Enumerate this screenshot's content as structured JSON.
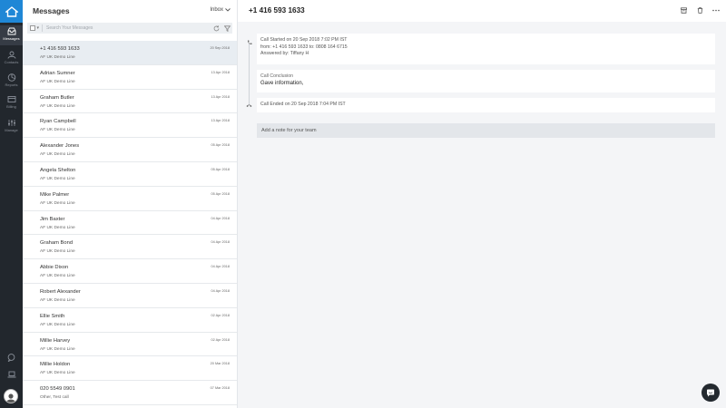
{
  "rail": {
    "items": [
      {
        "label": "Messages",
        "icon": "inbox-icon"
      },
      {
        "label": "Contacts",
        "icon": "contacts-icon"
      },
      {
        "label": "Reports",
        "icon": "reports-icon"
      },
      {
        "label": "Billing",
        "icon": "billing-icon"
      },
      {
        "label": "Manage",
        "icon": "sliders-icon"
      }
    ],
    "accent": "#1f87d6"
  },
  "list": {
    "title": "Messages",
    "filter": "Inbox",
    "search_placeholder": "Search Your Messages",
    "rows": [
      {
        "name": "+1 416 593 1633",
        "sub": "AF UK Demo Line",
        "date": "20 Sep 2018"
      },
      {
        "name": "Adrian Sumner",
        "sub": "AF UK Demo Line",
        "date": "13 Apr 2018"
      },
      {
        "name": "Graham Butler",
        "sub": "AF UK Demo Line",
        "date": "13 Apr 2018"
      },
      {
        "name": "Ryan Campbell",
        "sub": "AF UK Demo Line",
        "date": "13 Apr 2018"
      },
      {
        "name": "Alexander Jones",
        "sub": "AF UK Demo Line",
        "date": "05 Apr 2018"
      },
      {
        "name": "Angela Shelton",
        "sub": "AF UK Demo Line",
        "date": "05 Apr 2018"
      },
      {
        "name": "Mike Palmer",
        "sub": "AF UK Demo Line",
        "date": "05 Apr 2018"
      },
      {
        "name": "Jim Baxter",
        "sub": "AF UK Demo Line",
        "date": "04 Apr 2018"
      },
      {
        "name": "Graham Bond",
        "sub": "AF UK Demo Line",
        "date": "04 Apr 2018"
      },
      {
        "name": "Abbie Dixon",
        "sub": "AF UK Demo Line",
        "date": "04 Apr 2018"
      },
      {
        "name": "Robert Alexander",
        "sub": "AF UK Demo Line",
        "date": "04 Apr 2018"
      },
      {
        "name": "Ellie Smith",
        "sub": "AF UK Demo Line",
        "date": "02 Apr 2018"
      },
      {
        "name": "Millie Harvey",
        "sub": "AF UK Demo Line",
        "date": "02 Apr 2018"
      },
      {
        "name": "Millie Holdon",
        "sub": "AF UK Demo Line",
        "date": "20 Mar 2018"
      },
      {
        "name": "020 5549 0901",
        "sub": "Other, Test call",
        "date": "07 Mar 2018"
      }
    ]
  },
  "detail": {
    "title": "+1 416 593 1633",
    "call_started": "Call Started on 20 Sep 2018 7:02 PM IST",
    "from_to": "from: +1 416 593 1633  to: 0808 164 6715",
    "answered_by": "Answered by: Tiffany H",
    "conclusion_label": "Call Conclusion",
    "conclusion_value": "Gave information,",
    "call_ended": "Call Ended on 20 Sep 2018 7:04 PM IST",
    "note_placeholder": "Add a note for your team"
  }
}
